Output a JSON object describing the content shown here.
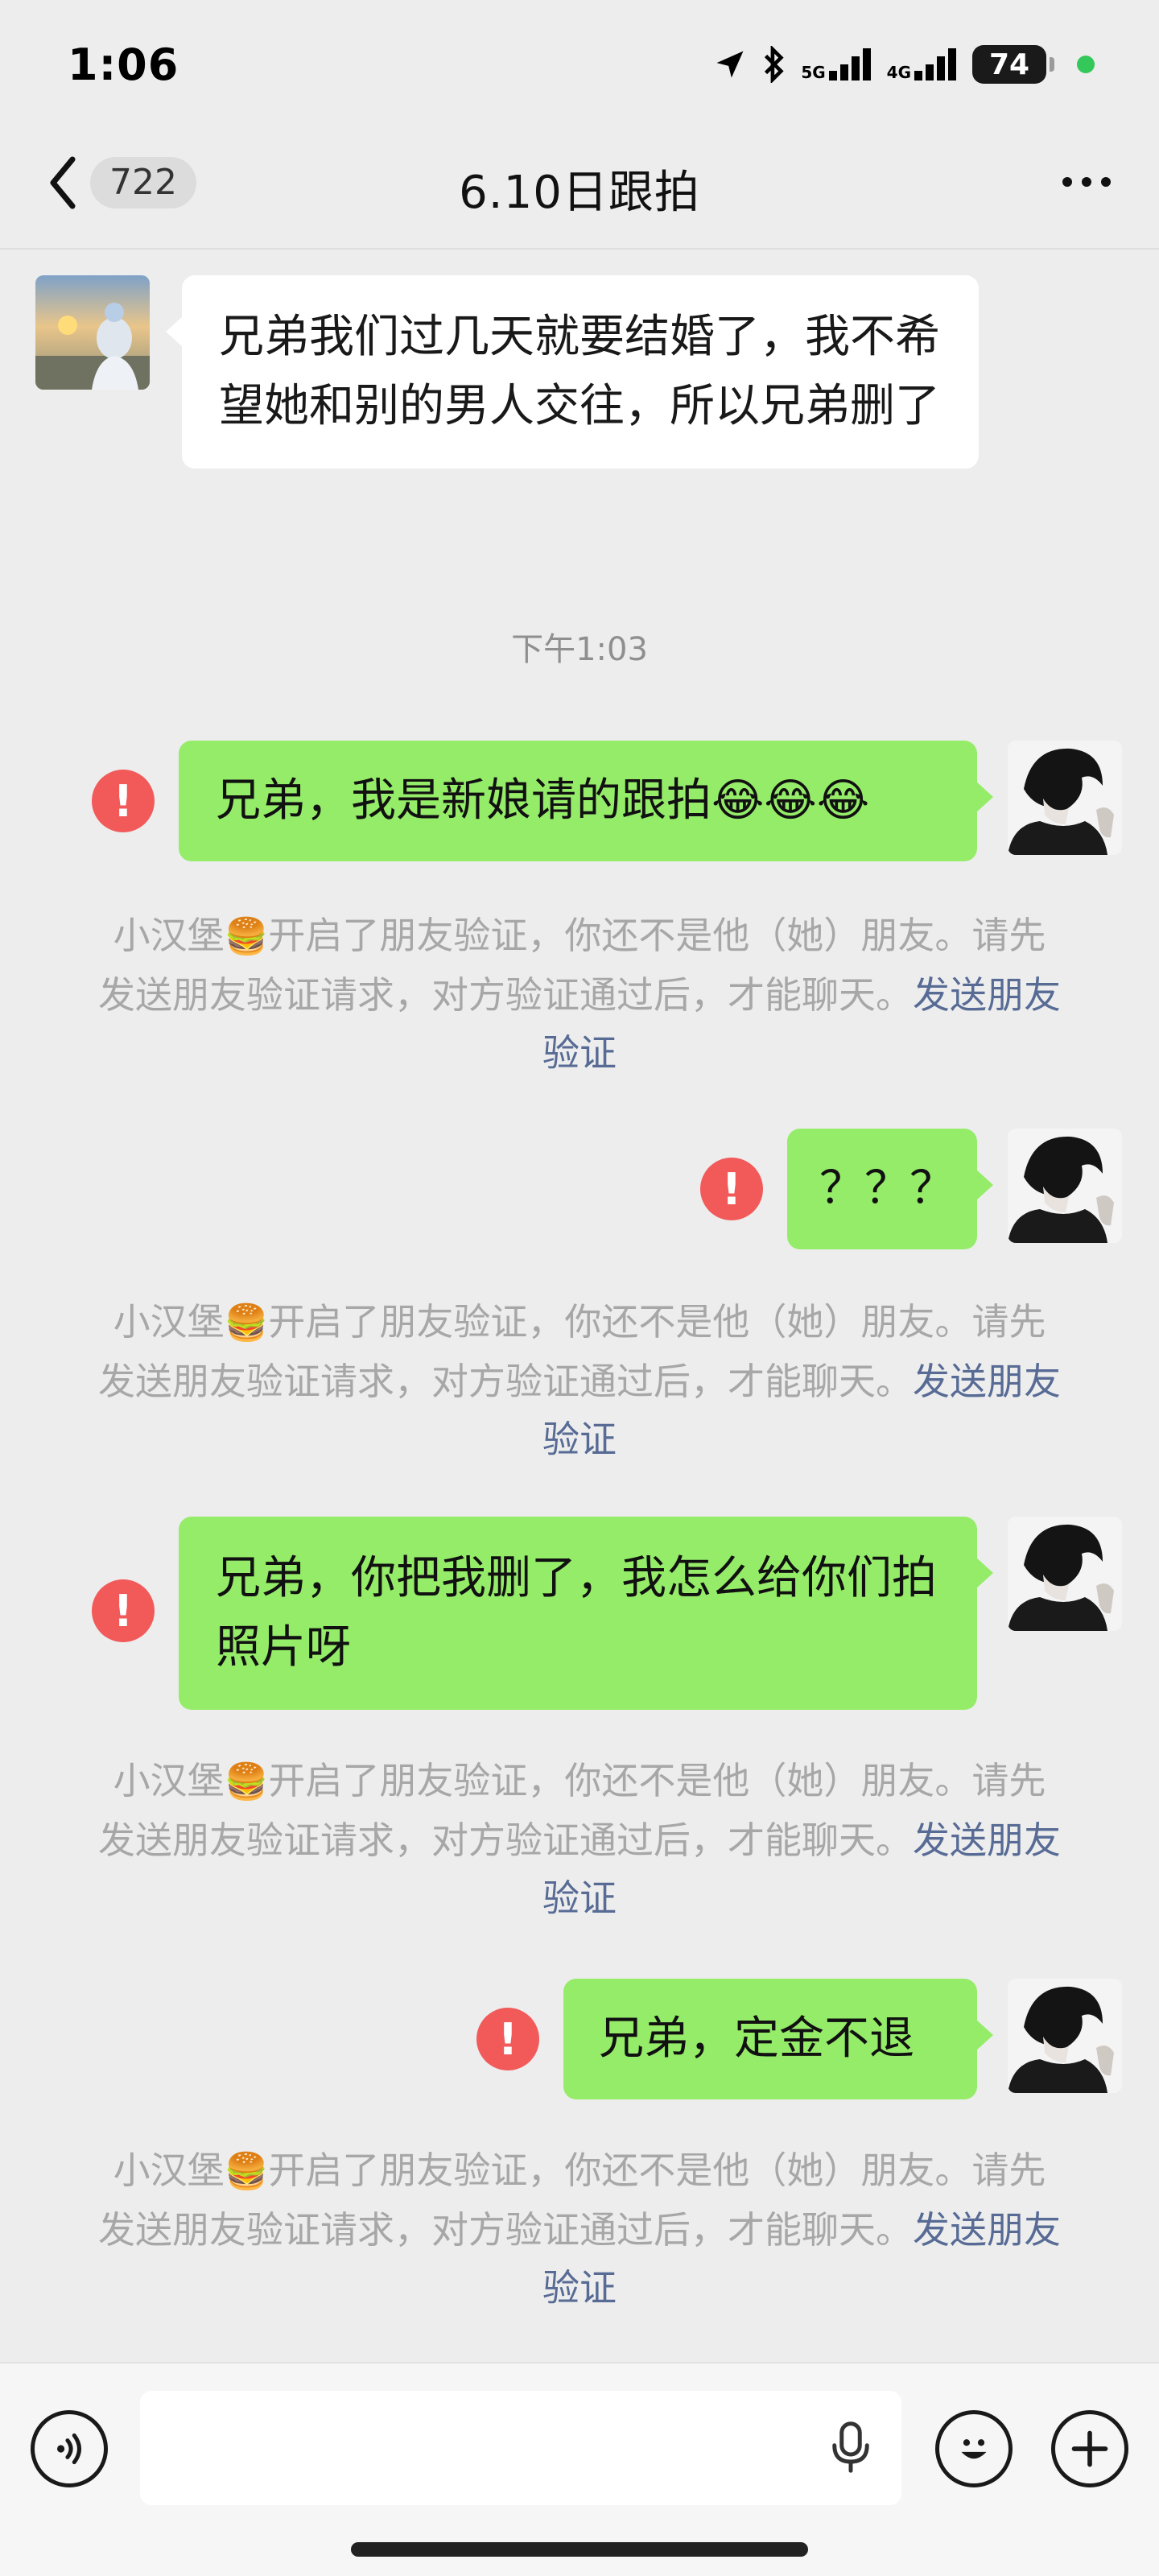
{
  "status_bar": {
    "time": "1:06",
    "network_5g": "5G",
    "network_4g": "4G",
    "battery": "74"
  },
  "header": {
    "unread_count": "722",
    "title": "6.10日跟拍"
  },
  "messages": {
    "m1": "兄弟我们过几天就要结婚了，我不希望她和别的男人交往，所以兄弟删了",
    "timestamp": "下午1:03",
    "m2": "兄弟，我是新娘请的跟拍😂😂😂",
    "m3": "？？？",
    "m4": "兄弟，你把我删了，我怎么给你们拍照片呀",
    "m5": "兄弟，定金不退"
  },
  "system_notice": {
    "name": "小汉堡",
    "emoji": "🍔",
    "text": "开启了朋友验证，你还不是他（她）朋友。请先发送朋友验证请求，对方验证通过后，才能聊天。",
    "link": "发送朋友验证"
  },
  "error_mark": "!",
  "colors": {
    "outgoing_bubble": "#95ec69",
    "incoming_bubble": "#ffffff",
    "error": "#f25a5a",
    "link": "#576b95",
    "system_text": "#a7a7a7"
  }
}
